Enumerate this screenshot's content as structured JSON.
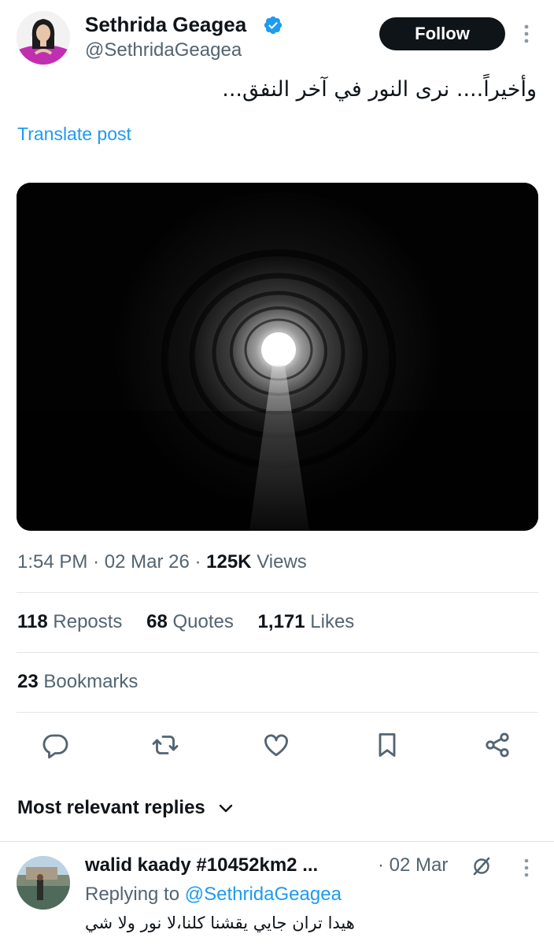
{
  "post": {
    "author_name": "Sethrida Geagea",
    "author_handle": "@SethridaGeagea",
    "follow_label": "Follow",
    "text": "وأخيراً.... نرى النور في آخر النفق...",
    "translate_label": "Translate post",
    "image_icon": "tunnel-photo",
    "time": "1:54 PM",
    "date": "02 Mar 26",
    "views_count": "125K",
    "views_label": "Views",
    "separator": "·"
  },
  "stats": {
    "reposts_count": "118",
    "reposts_label": "Reposts",
    "quotes_count": "68",
    "quotes_label": "Quotes",
    "likes_count": "1,171",
    "likes_label": "Likes",
    "bookmarks_count": "23",
    "bookmarks_label": "Bookmarks"
  },
  "actions": {
    "icons": [
      "reply-icon",
      "repost-icon",
      "like-icon",
      "bookmark-icon",
      "share-icon"
    ]
  },
  "replies": {
    "header_label": "Most relevant replies",
    "items": [
      {
        "name": "walid kaady #10452km2 ...",
        "date": "· 02 Mar",
        "replying_prefix": "Replying to",
        "replying_handle": "@SethridaGeagea",
        "text": "هيدا تران جايي يقشنا كلنا،لا نور ولا شي"
      }
    ]
  },
  "colors": {
    "accent": "#1d9bf0",
    "text_primary": "#0f1419",
    "text_secondary": "#536471",
    "follow_bg": "#0f1419"
  }
}
